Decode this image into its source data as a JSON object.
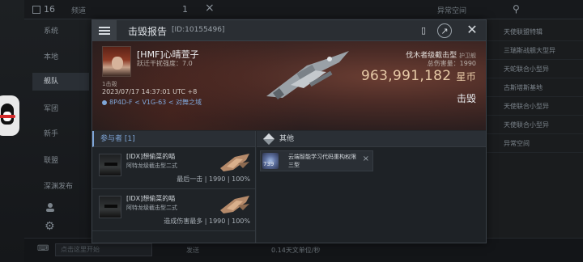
{
  "background": {
    "count_badge": "16",
    "chat_tab": "频道",
    "tab2_count": "1",
    "right_tab": "异常空间",
    "side_items": [
      "系统",
      "本地",
      "舰队",
      "军团",
      "新手",
      "联盟",
      "深渊发布"
    ],
    "active_side_index": 2,
    "right_list": [
      "天使联盟特辑",
      "三瑞斯战舰大型异",
      "天蛇联合小型异",
      "古斯塔斯基地",
      "天使联合小型异",
      "天使联合小型异",
      "异常空间"
    ],
    "input_placeholder": "点击这里开始",
    "send_label": "发送",
    "speed_text": "0.14天文单位/秒"
  },
  "dialog": {
    "title": "击毁报告",
    "report_id": "[ID:10155496]",
    "victim": {
      "name": "[HMF]心晴萱子",
      "subtitle": "跃迁干扰强度：7.0",
      "rank": "1击毁",
      "datetime": "2023/07/17 14:37:01 UTC +8",
      "location": "8P4D-F < V1G-63 < 对舞之域"
    },
    "ship": {
      "class": "伐木者级截击型",
      "class_type": "护卫舰",
      "damage_label": "总伤害量：",
      "damage_value": "1990",
      "isk_value": "963,991,182",
      "isk_unit": "星币",
      "result": "击毁"
    },
    "participants": {
      "header": "参与者 [1]",
      "list": [
        {
          "name": "[IDX]想偷菜的喵",
          "ship": "阿特龙级截击型二式",
          "role": "最后一击",
          "damage": "1990",
          "percent": "100%"
        },
        {
          "name": "[IDX]想偷菜的喵",
          "ship": "阿特龙级截击型二式",
          "role": "造成伤害最多",
          "damage": "1990",
          "percent": "100%"
        }
      ]
    },
    "other": {
      "header": "其他",
      "items": [
        {
          "qty": "739",
          "name": "云端智能学习代码重构权限 三型"
        }
      ]
    }
  },
  "colors": {
    "accent_blue": "#7fa6d8",
    "isk_gold": "#e6c9a6"
  }
}
